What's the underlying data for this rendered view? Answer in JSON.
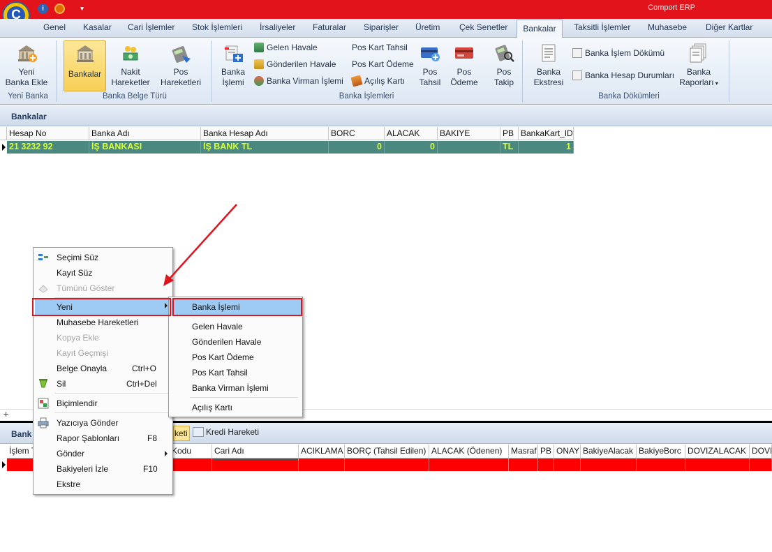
{
  "app": {
    "title": "Comport ERP"
  },
  "menu_tabs": [
    "Genel",
    "Kasalar",
    "Cari İşlemler",
    "Stok İşlemleri",
    "İrsaliyeler",
    "Faturalar",
    "Siparişler",
    "Üretim",
    "Çek Senetler",
    "Bankalar",
    "Taksitli İşlemler",
    "Muhasebe",
    "Diğer Kartlar"
  ],
  "active_tab": "Bankalar",
  "ribbon": {
    "yeni_banka": {
      "btn1": "Yeni",
      "btn2": "Banka Ekle",
      "caption": "Yeni Banka"
    },
    "belge_turu": {
      "bankalar": "Bankalar",
      "nakit1": "Nakit",
      "nakit2": "Hareketler",
      "pos1": "Pos",
      "pos2": "Hareketleri",
      "caption": "Banka Belge Türü"
    },
    "islemleri": {
      "banka1": "Banka",
      "banka2": "İşlemi",
      "gelen": "Gelen Havale",
      "gonderilen": "Gönderilen Havale",
      "virman": "Banka Virman İşlemi",
      "tahsil": "Pos Kart Tahsil",
      "odeme": "Pos Kart Ödeme",
      "acilis": "Açılış Kartı",
      "postahsil1": "Pos",
      "postahsil2": "Tahsil",
      "posodeme1": "Pos",
      "posodeme2": "Ödeme",
      "postakip1": "Pos",
      "postakip2": "Takip",
      "caption": "Banka İşlemleri"
    },
    "dokumleri": {
      "ekstre1": "Banka",
      "ekstre2": "Ekstresi",
      "islem_dokumu": "Banka İşlem Dökümü",
      "hesap_durum": "Banka Hesap Durumları",
      "rapor1": "Banka",
      "rapor2": "Raporları",
      "caption": "Banka Dökümleri"
    }
  },
  "section_title": "Bankalar",
  "bank_grid": {
    "columns": [
      "Hesap No",
      "Banka Adı",
      "Banka Hesap Adı",
      "BORC",
      "ALACAK",
      "BAKIYE",
      "PB",
      "BankaKart_ID"
    ],
    "row": [
      "21 3232 92",
      "İŞ BANKASI",
      "İŞ BANK TL",
      "0",
      "0",
      "",
      "TL",
      "1"
    ]
  },
  "lower": {
    "title_partial": "Bank",
    "tab_partial": "keti",
    "tab2": "Kredi Hareketi",
    "columns": [
      "İşlem T",
      "Kodu",
      "Cari Adı",
      "ACIKLAMA",
      "BORÇ (Tahsil Edilen)",
      "ALACAK (Ödenen)",
      "Masraf",
      "PB",
      "ONAY",
      "BakiyeAlacak",
      "BakiyeBorc",
      "DOVIZALACAK",
      "DOVI"
    ]
  },
  "context_menu": {
    "items": [
      {
        "label": "Seçimi Süz",
        "shortcut": "",
        "disabled": false
      },
      {
        "label": "Kayıt Süz",
        "shortcut": "",
        "disabled": false
      },
      {
        "label": "Tümünü Göster",
        "shortcut": "",
        "disabled": true
      },
      {
        "label": "Yeni",
        "shortcut": "",
        "disabled": false
      },
      {
        "label": "Muhasebe Hareketleri",
        "shortcut": "",
        "disabled": false
      },
      {
        "label": "Kopya Ekle",
        "shortcut": "",
        "disabled": true
      },
      {
        "label": "Kayıt Geçmişi",
        "shortcut": "",
        "disabled": true
      },
      {
        "label": "Belge Onayla",
        "shortcut": "Ctrl+O",
        "disabled": false
      },
      {
        "label": "Sil",
        "shortcut": "Ctrl+Del",
        "disabled": false
      },
      {
        "label": "Biçimlendir",
        "shortcut": "",
        "disabled": false
      },
      {
        "label": "Yazıcıya Gönder",
        "shortcut": "",
        "disabled": false
      },
      {
        "label": "Rapor Şablonları",
        "shortcut": "F8",
        "disabled": false
      },
      {
        "label": "Gönder",
        "shortcut": "",
        "disabled": false
      },
      {
        "label": "Bakiyeleri İzle",
        "shortcut": "F10",
        "disabled": false
      },
      {
        "label": "Ekstre",
        "shortcut": "",
        "disabled": false
      }
    ]
  },
  "submenu": {
    "items": [
      "Banka İşlemi",
      "Gelen Havale",
      "Gönderilen Havale",
      "Pos Kart Ödeme",
      "Pos Kart Tahsil",
      "Banka Virman İşlemi",
      "Açılış Kartı"
    ]
  },
  "colors": {
    "titlebar": "#e3131c",
    "selected_row": "#4a8880",
    "selected_text": "#d9ff2d",
    "annotation": "#e0141c",
    "menu_highlight": "#9ecbf4"
  }
}
